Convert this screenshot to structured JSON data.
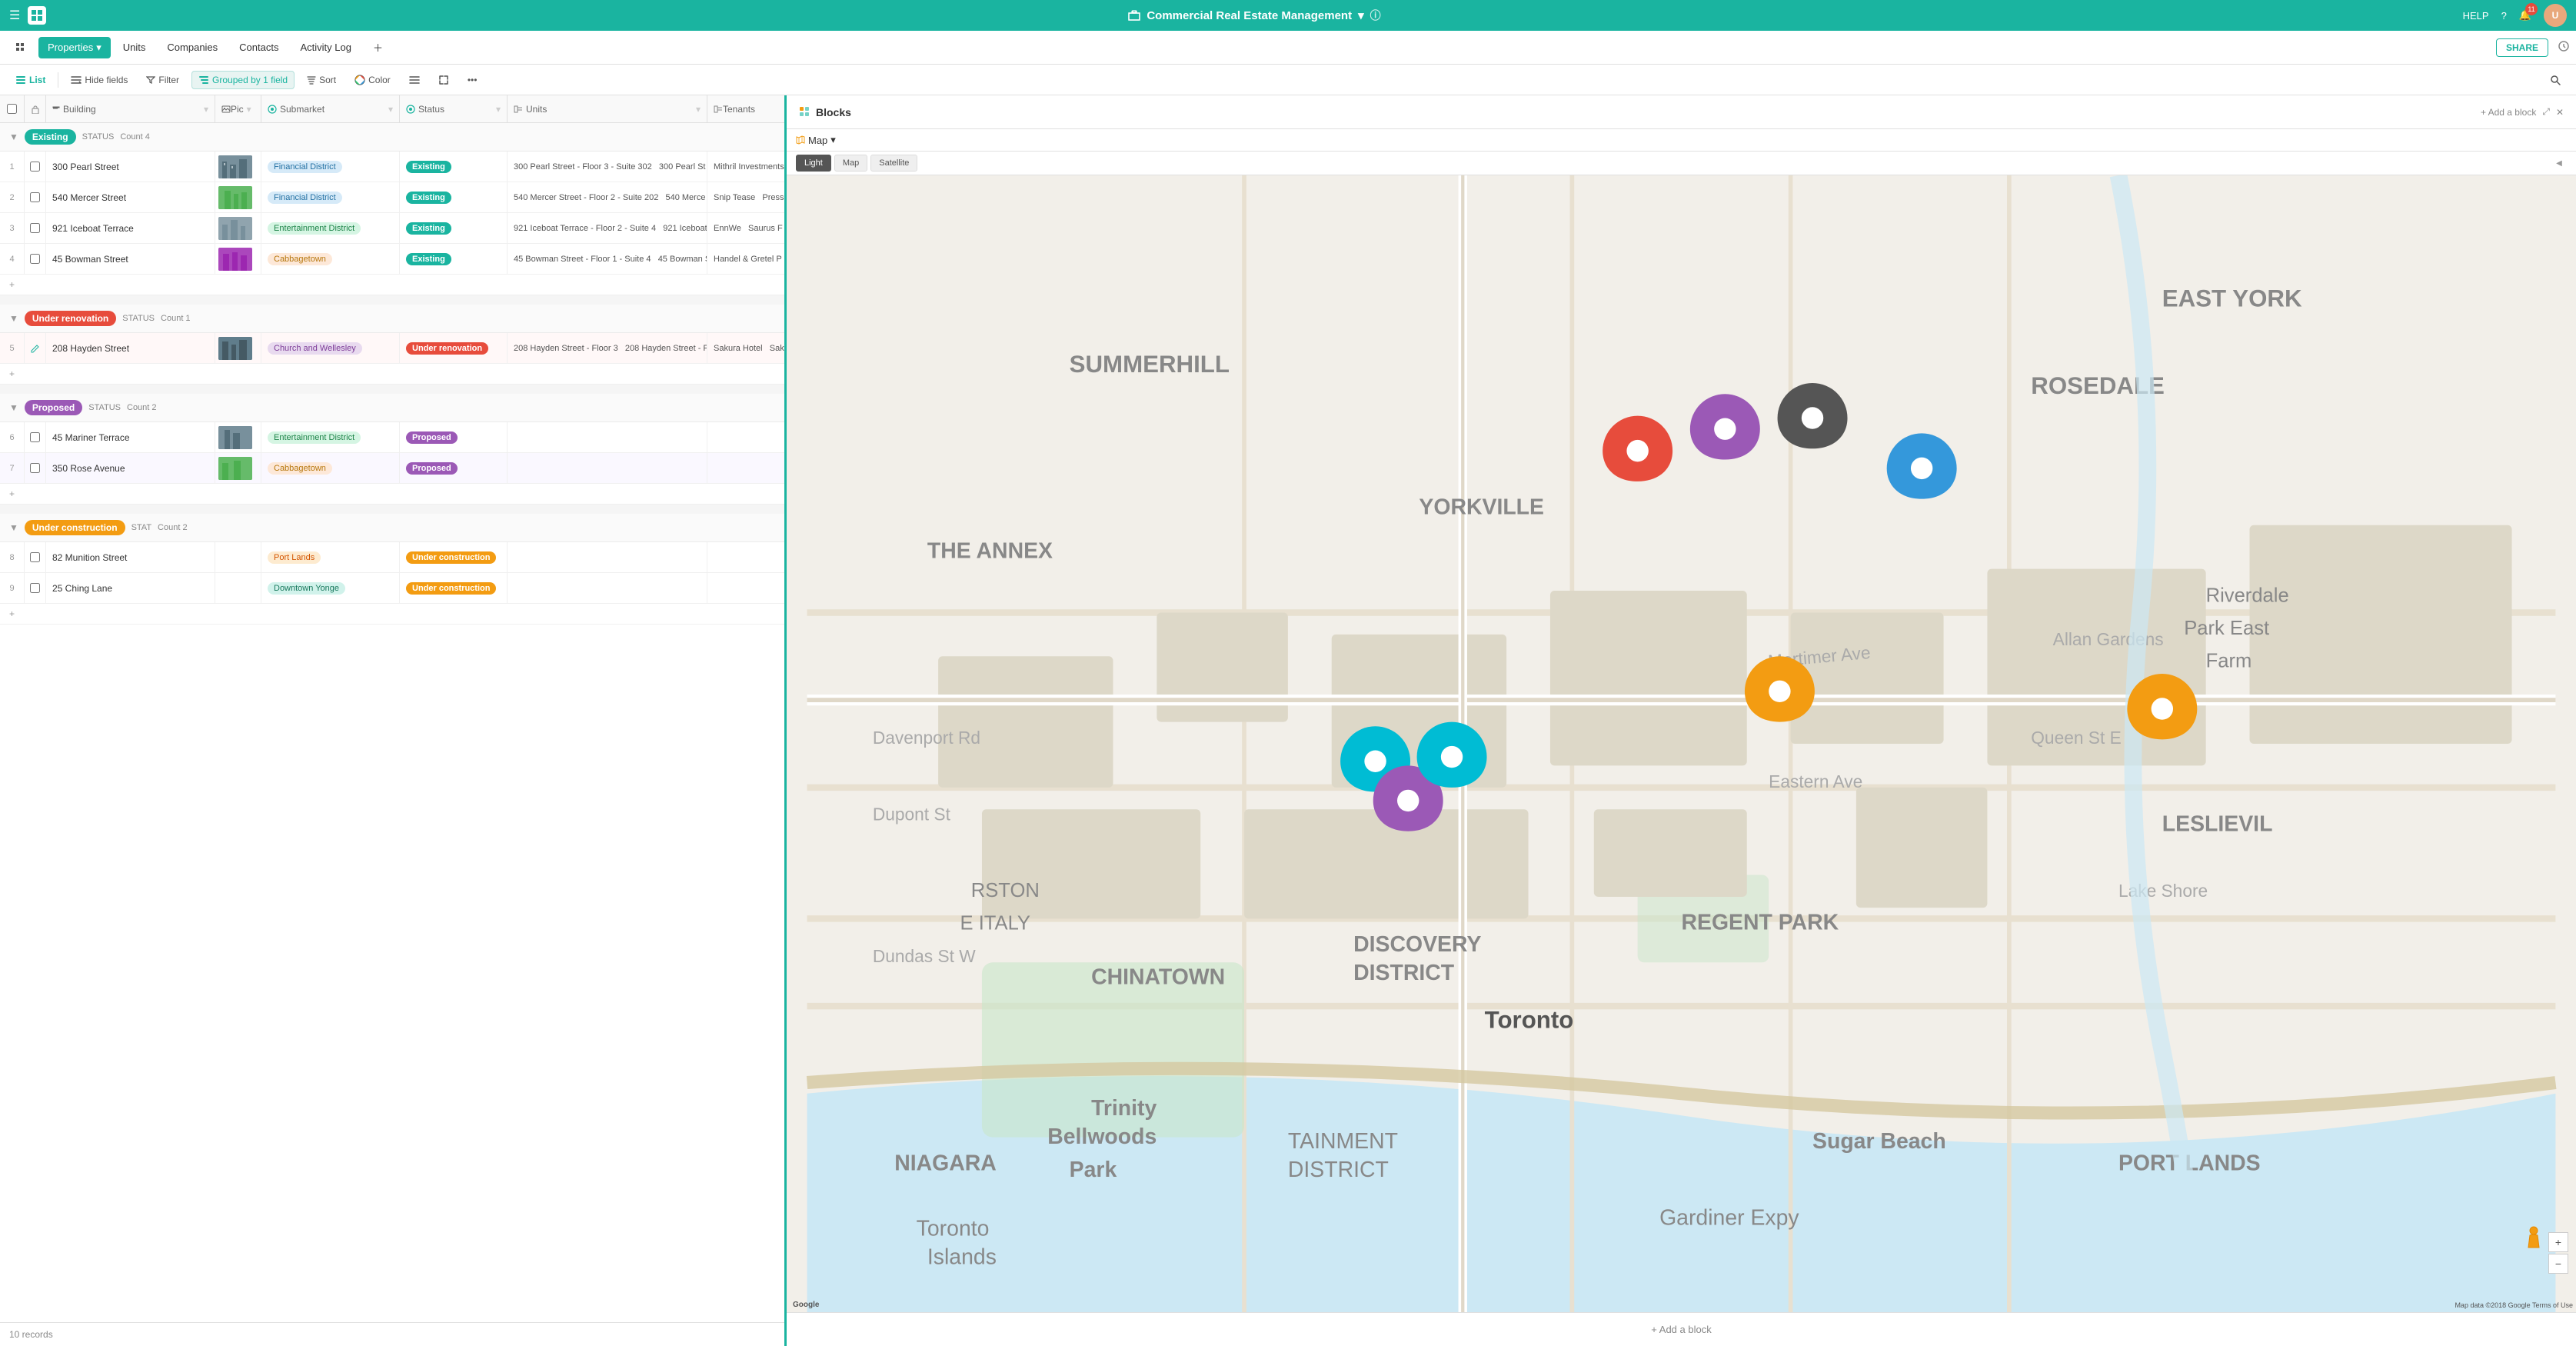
{
  "app": {
    "title": "Commercial Real Estate Management",
    "logo": "⊞",
    "help_label": "HELP",
    "notif_count": "11"
  },
  "nav": {
    "items": [
      {
        "id": "properties",
        "label": "Properties",
        "active": true,
        "has_arrow": true
      },
      {
        "id": "units",
        "label": "Units",
        "active": false
      },
      {
        "id": "companies",
        "label": "Companies",
        "active": false
      },
      {
        "id": "contacts",
        "label": "Contacts",
        "active": false
      },
      {
        "id": "activity-log",
        "label": "Activity Log",
        "active": false
      }
    ],
    "share_label": "SHARE"
  },
  "toolbar": {
    "list_label": "List",
    "hide_fields_label": "Hide fields",
    "filter_label": "Filter",
    "group_label": "Grouped by 1 field",
    "sort_label": "Sort",
    "color_label": "Color",
    "search_placeholder": "Search"
  },
  "table": {
    "columns": [
      "Building",
      "Pic",
      "Submarket",
      "Status",
      "Units",
      "Tenants"
    ],
    "groups": [
      {
        "id": "existing",
        "label": "Existing",
        "badge_class": "badge-existing",
        "status_label": "STATUS",
        "count_label": "Count 4",
        "rows": [
          {
            "num": "1",
            "building": "300 Pearl Street",
            "submarket": "Financial District",
            "submarket_class": "tag-financial",
            "status": "Existing",
            "status_class": "badge-existing",
            "units": "300 Pearl Street - Floor 3 - Suite 302  300 Pearl St",
            "tenants": "Mithril Investments"
          },
          {
            "num": "2",
            "building": "540 Mercer Street",
            "submarket": "Financial District",
            "submarket_class": "tag-financial",
            "status": "Existing",
            "status_class": "badge-existing",
            "units": "540 Mercer Street - Floor 2 - Suite 202  540 Merce",
            "tenants": "Snip Tease  Press"
          },
          {
            "num": "3",
            "building": "921 Iceboat Terrace",
            "submarket": "Entertainment District",
            "submarket_class": "tag-entertainment",
            "status": "Existing",
            "status_class": "badge-existing",
            "units": "921 Iceboat Terrace - Floor 2 - Suite 4  921 Iceboat",
            "tenants": "EnnWe  Saurus F"
          },
          {
            "num": "4",
            "building": "45 Bowman Street",
            "submarket": "Cabbagetown",
            "submarket_class": "tag-cabbagetown",
            "status": "Existing",
            "status_class": "badge-existing",
            "units": "45 Bowman Street - Floor 1 - Suite 4  45 Bowman S",
            "tenants": "Handel & Gretel P"
          }
        ]
      },
      {
        "id": "under-renovation",
        "label": "Under renovation",
        "badge_class": "badge-under-renovation",
        "status_label": "STATUS",
        "count_label": "Count 1",
        "rows": [
          {
            "num": "5",
            "building": "208 Hayden Street",
            "submarket": "Church and Wellesley",
            "submarket_class": "tag-church",
            "status": "Under renovation",
            "status_class": "badge-under-renovation",
            "units": "208 Hayden Street - Floor 3  208 Hayden Street - F",
            "tenants": "Sakura Hotel  Sak"
          }
        ]
      },
      {
        "id": "proposed",
        "label": "Proposed",
        "badge_class": "badge-proposed",
        "status_label": "STATUS",
        "count_label": "Count 2",
        "rows": [
          {
            "num": "6",
            "building": "45 Mariner Terrace",
            "submarket": "Entertainment District",
            "submarket_class": "tag-entertainment",
            "status": "Proposed",
            "status_class": "badge-proposed",
            "units": "",
            "tenants": ""
          },
          {
            "num": "7",
            "building": "350 Rose Avenue",
            "submarket": "Cabbagetown",
            "submarket_class": "tag-cabbagetown",
            "status": "Proposed",
            "status_class": "badge-proposed",
            "units": "",
            "tenants": ""
          }
        ]
      },
      {
        "id": "under-construction",
        "label": "Under construction",
        "badge_class": "badge-under-construction",
        "status_label": "STAT",
        "count_label": "Count 2",
        "rows": [
          {
            "num": "8",
            "building": "82 Munition Street",
            "submarket": "Port Lands",
            "submarket_class": "tag-portlands",
            "status": "Under construction",
            "status_class": "badge-under-construction",
            "units": "",
            "tenants": ""
          },
          {
            "num": "9",
            "building": "25 Ching Lane",
            "submarket": "Downtown Yonge",
            "submarket_class": "tag-downtown",
            "status": "Under construction",
            "status_class": "badge-under-construction",
            "units": "",
            "tenants": ""
          }
        ]
      }
    ],
    "footer": "10 records"
  },
  "blocks": {
    "title": "Blocks",
    "add_block_label": "+ Add a block",
    "map_dropdown_label": "Map",
    "map_views": [
      "Light",
      "Map",
      "Satellite"
    ],
    "active_view": "Light",
    "zoom_in": "+",
    "zoom_out": "−",
    "attribution": "Map data ©2018 Google  Terms of Use",
    "add_block_footer": "+ Add a block",
    "street_view_label": "🚶"
  },
  "map_areas": [
    {
      "id": "summerhill",
      "label": "SUMMERHILL"
    },
    {
      "id": "rosedale",
      "label": "ROSEDALE"
    },
    {
      "id": "east-york",
      "label": "EAST YORK"
    },
    {
      "id": "the-annex",
      "label": "THE ANNEX"
    },
    {
      "id": "yorkville",
      "label": "YORKVILLE"
    },
    {
      "id": "toronto",
      "label": "Toronto"
    },
    {
      "id": "chinatown",
      "label": "CHINATOWN"
    },
    {
      "id": "discovery-district",
      "label": "DISCOVERY DISTRICT"
    },
    {
      "id": "niagara",
      "label": "NIAGARA"
    },
    {
      "id": "port-lands",
      "label": "Port Lands"
    },
    {
      "id": "entertainment-district",
      "label": "TAINMENT DISTRICT"
    }
  ],
  "map_pins": [
    {
      "id": "pin1",
      "color": "#e74c3c",
      "x": "48%",
      "y": "28%"
    },
    {
      "id": "pin2",
      "color": "#9b59b6",
      "x": "52%",
      "y": "26%"
    },
    {
      "id": "pin3",
      "color": "#9b59b6",
      "x": "60%",
      "y": "27%"
    },
    {
      "id": "pin4",
      "color": "#3498db",
      "x": "65%",
      "y": "32%"
    },
    {
      "id": "pin5",
      "color": "#333333",
      "x": "53%",
      "y": "33%"
    },
    {
      "id": "pin6",
      "color": "#f39c12",
      "x": "55%",
      "y": "48%"
    },
    {
      "id": "pin7",
      "color": "#3498db",
      "x": "33%",
      "y": "54%"
    },
    {
      "id": "pin8",
      "color": "#9b59b6",
      "x": "34%",
      "y": "57%"
    },
    {
      "id": "pin9",
      "color": "#3498db",
      "x": "37%",
      "y": "54%"
    },
    {
      "id": "pin10",
      "color": "#f39c12",
      "x": "78%",
      "y": "50%"
    }
  ]
}
